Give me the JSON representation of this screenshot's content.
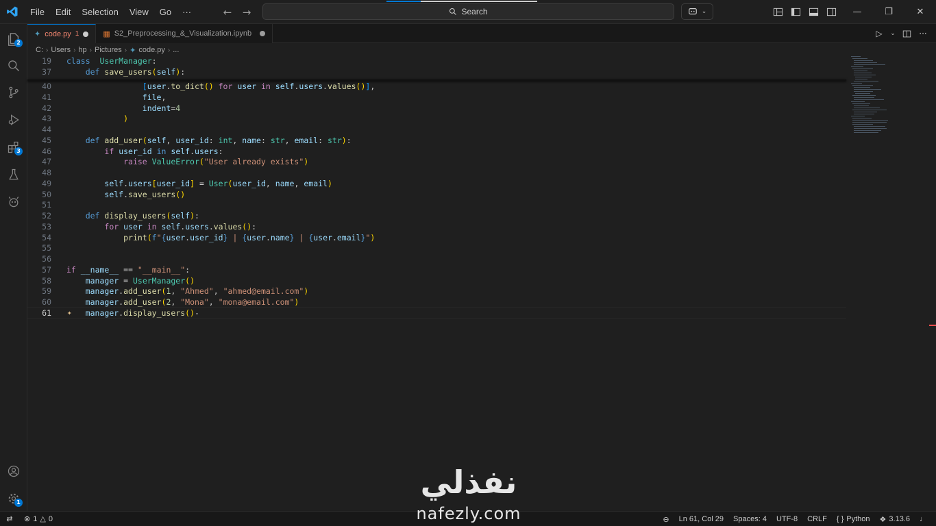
{
  "menu": {
    "items": [
      "File",
      "Edit",
      "Selection",
      "View",
      "Go",
      "···"
    ]
  },
  "search": {
    "label": "Search"
  },
  "tabs": [
    {
      "name": "code.py",
      "errors": "1",
      "active": true
    },
    {
      "name": "S2_Preprocessing_&_Visualization.ipynb",
      "active": false
    }
  ],
  "breadcrumb": [
    "C:",
    "Users",
    "hp",
    "Pictures",
    "code.py",
    "..."
  ],
  "activity_badges": {
    "explorer": "2",
    "extensions": "3",
    "settings": "1"
  },
  "editor": {
    "lines": [
      {
        "n": "19",
        "tokens": [
          [
            "kw",
            "class"
          ],
          [
            "",
            "  "
          ],
          [
            "cls",
            "UserManager"
          ],
          [
            "",
            ":"
          ]
        ]
      },
      {
        "n": "37",
        "tokens": [
          [
            "",
            "    "
          ],
          [
            "kw",
            "def"
          ],
          [
            "",
            ""
          ],
          [
            "fn",
            "save_users"
          ],
          [
            "br1",
            "("
          ],
          [
            "var",
            "self"
          ],
          [
            "br1",
            ")"
          ],
          [
            "",
            ":"
          ]
        ]
      },
      {
        "n": "40",
        "tokens": [
          [
            "",
            "                "
          ],
          [
            "br3",
            "["
          ],
          [
            "var",
            "user"
          ],
          [
            "",
            "."
          ],
          [
            "fn",
            "to_dict"
          ],
          [
            "br1",
            "()"
          ],
          [
            "",
            ""
          ],
          [
            "kw2",
            "for"
          ],
          [
            "",
            ""
          ],
          [
            "var",
            "user"
          ],
          [
            "",
            ""
          ],
          [
            "kw2",
            "in"
          ],
          [
            "",
            ""
          ],
          [
            "var",
            "self"
          ],
          [
            "",
            "."
          ],
          [
            "var",
            "users"
          ],
          [
            "",
            "."
          ],
          [
            "fn",
            "values"
          ],
          [
            "br1",
            "()"
          ],
          [
            "br3",
            "]"
          ],
          [
            "",
            ","
          ]
        ]
      },
      {
        "n": "41",
        "tokens": [
          [
            "",
            "                "
          ],
          [
            "var",
            "file"
          ],
          [
            "",
            ","
          ]
        ]
      },
      {
        "n": "42",
        "tokens": [
          [
            "",
            "                "
          ],
          [
            "var",
            "indent"
          ],
          [
            "",
            "="
          ],
          [
            "num",
            "4"
          ]
        ]
      },
      {
        "n": "43",
        "tokens": [
          [
            "",
            "            "
          ],
          [
            "br1",
            ")"
          ]
        ]
      },
      {
        "n": "44",
        "tokens": []
      },
      {
        "n": "45",
        "tokens": [
          [
            "",
            "    "
          ],
          [
            "kw",
            "def"
          ],
          [
            "",
            ""
          ],
          [
            "fn",
            "add_user"
          ],
          [
            "br1",
            "("
          ],
          [
            "var",
            "self"
          ],
          [
            "",
            ","
          ],
          [
            "var",
            "user_id"
          ],
          [
            "",
            ":"
          ],
          [
            "cls",
            "int"
          ],
          [
            "",
            ","
          ],
          [
            "var",
            "name"
          ],
          [
            "",
            ":"
          ],
          [
            "cls",
            "str"
          ],
          [
            "",
            ","
          ],
          [
            "var",
            "email"
          ],
          [
            "",
            ":"
          ],
          [
            "cls",
            "str"
          ],
          [
            "br1",
            ")"
          ],
          [
            "",
            ":"
          ]
        ]
      },
      {
        "n": "46",
        "tokens": [
          [
            "",
            "        "
          ],
          [
            "kw2",
            "if"
          ],
          [
            "",
            ""
          ],
          [
            "var",
            "user_id"
          ],
          [
            "",
            ""
          ],
          [
            "kw",
            "in"
          ],
          [
            "",
            ""
          ],
          [
            "var",
            "self"
          ],
          [
            "",
            "."
          ],
          [
            "var",
            "users"
          ],
          [
            "",
            ":"
          ]
        ]
      },
      {
        "n": "47",
        "tokens": [
          [
            "",
            "            "
          ],
          [
            "kw2",
            "raise"
          ],
          [
            "",
            ""
          ],
          [
            "cls",
            "ValueError"
          ],
          [
            "br1",
            "("
          ],
          [
            "str",
            "\"User already exists\""
          ],
          [
            "br1",
            ")"
          ]
        ]
      },
      {
        "n": "48",
        "tokens": []
      },
      {
        "n": "49",
        "tokens": [
          [
            "",
            "        "
          ],
          [
            "var",
            "self"
          ],
          [
            "",
            "."
          ],
          [
            "var",
            "users"
          ],
          [
            "br1",
            "["
          ],
          [
            "var",
            "user_id"
          ],
          [
            "br1",
            "]"
          ],
          [
            "",
            ""
          ],
          [
            "",
            "="
          ],
          [
            "",
            ""
          ],
          [
            "cls",
            "User"
          ],
          [
            "br1",
            "("
          ],
          [
            "var",
            "user_id"
          ],
          [
            "",
            ","
          ],
          [
            "var",
            "name"
          ],
          [
            "",
            ","
          ],
          [
            "var",
            "email"
          ],
          [
            "br1",
            ")"
          ]
        ]
      },
      {
        "n": "50",
        "tokens": [
          [
            "",
            "        "
          ],
          [
            "var",
            "self"
          ],
          [
            "",
            "."
          ],
          [
            "fn",
            "save_users"
          ],
          [
            "br1",
            "()"
          ]
        ]
      },
      {
        "n": "51",
        "tokens": []
      },
      {
        "n": "52",
        "tokens": [
          [
            "",
            "    "
          ],
          [
            "kw",
            "def"
          ],
          [
            "",
            ""
          ],
          [
            "fn",
            "display_users"
          ],
          [
            "br1",
            "("
          ],
          [
            "var",
            "self"
          ],
          [
            "br1",
            ")"
          ],
          [
            "",
            ":"
          ]
        ]
      },
      {
        "n": "53",
        "tokens": [
          [
            "",
            "        "
          ],
          [
            "kw2",
            "for"
          ],
          [
            "",
            ""
          ],
          [
            "var",
            "user"
          ],
          [
            "",
            ""
          ],
          [
            "kw2",
            "in"
          ],
          [
            "",
            ""
          ],
          [
            "var",
            "self"
          ],
          [
            "",
            "."
          ],
          [
            "var",
            "users"
          ],
          [
            "",
            "."
          ],
          [
            "fn",
            "values"
          ],
          [
            "br1",
            "()"
          ],
          [
            "",
            ":"
          ]
        ]
      },
      {
        "n": "54",
        "tokens": [
          [
            "",
            "            "
          ],
          [
            "fn",
            "print"
          ],
          [
            "br1",
            "("
          ],
          [
            "kw",
            "f"
          ],
          [
            "str",
            "\""
          ],
          [
            "kw",
            "{"
          ],
          [
            "var",
            "user"
          ],
          [
            "",
            "."
          ],
          [
            "var",
            "user_id"
          ],
          [
            "kw",
            "}"
          ],
          [
            "str",
            " | "
          ],
          [
            "kw",
            "{"
          ],
          [
            "var",
            "user"
          ],
          [
            "",
            "."
          ],
          [
            "var",
            "name"
          ],
          [
            "kw",
            "}"
          ],
          [
            "str",
            " | "
          ],
          [
            "kw",
            "{"
          ],
          [
            "var",
            "user"
          ],
          [
            "",
            "."
          ],
          [
            "var",
            "email"
          ],
          [
            "kw",
            "}"
          ],
          [
            "str",
            "\""
          ],
          [
            "br1",
            ")"
          ]
        ]
      },
      {
        "n": "55",
        "tokens": []
      },
      {
        "n": "56",
        "tokens": []
      },
      {
        "n": "57",
        "tokens": [
          [
            "kw2",
            "if"
          ],
          [
            "",
            ""
          ],
          [
            "var",
            "__name__"
          ],
          [
            "",
            ""
          ],
          [
            "",
            "=="
          ],
          [
            "",
            ""
          ],
          [
            "str",
            "\"__main__\""
          ],
          [
            "",
            ":"
          ]
        ]
      },
      {
        "n": "58",
        "tokens": [
          [
            "",
            "    "
          ],
          [
            "var",
            "manager"
          ],
          [
            "",
            ""
          ],
          [
            "",
            "="
          ],
          [
            "",
            ""
          ],
          [
            "cls",
            "UserManager"
          ],
          [
            "br1",
            "()"
          ]
        ]
      },
      {
        "n": "59",
        "tokens": [
          [
            "",
            "    "
          ],
          [
            "var",
            "manager"
          ],
          [
            "",
            "."
          ],
          [
            "fn",
            "add_user"
          ],
          [
            "br1",
            "("
          ],
          [
            "num",
            "1"
          ],
          [
            "",
            ","
          ],
          [
            "str",
            "\"Ahmed\""
          ],
          [
            "",
            ","
          ],
          [
            "str",
            "\"ahmed@email.com\""
          ],
          [
            "br1",
            ")"
          ]
        ]
      },
      {
        "n": "60",
        "tokens": [
          [
            "",
            "    "
          ],
          [
            "var",
            "manager"
          ],
          [
            "",
            "."
          ],
          [
            "fn",
            "add_user"
          ],
          [
            "br1",
            "("
          ],
          [
            "num",
            "2"
          ],
          [
            "",
            ","
          ],
          [
            "str",
            "\"Mona\""
          ],
          [
            "",
            ","
          ],
          [
            "str",
            "\"mona@email.com\""
          ],
          [
            "br1",
            ")"
          ]
        ]
      },
      {
        "n": "61",
        "tokens": [
          [
            "",
            "    "
          ],
          [
            "var",
            "manager"
          ],
          [
            "",
            "."
          ],
          [
            "fn",
            "display_users"
          ],
          [
            "br1",
            "()"
          ],
          [
            "",
            "-"
          ]
        ]
      }
    ]
  },
  "status": {
    "errors": "1",
    "warnings": "0",
    "position": "Ln 61, Col 29",
    "spaces": "Spaces: 4",
    "encoding": "UTF-8",
    "eol": "CRLF",
    "language": "Python",
    "python_version": "3.13.6"
  },
  "watermark": {
    "arabic": "نفذلي",
    "latin": "nafezly.com"
  },
  "colors": {
    "accent": "#0078d4",
    "error": "#f48771"
  }
}
